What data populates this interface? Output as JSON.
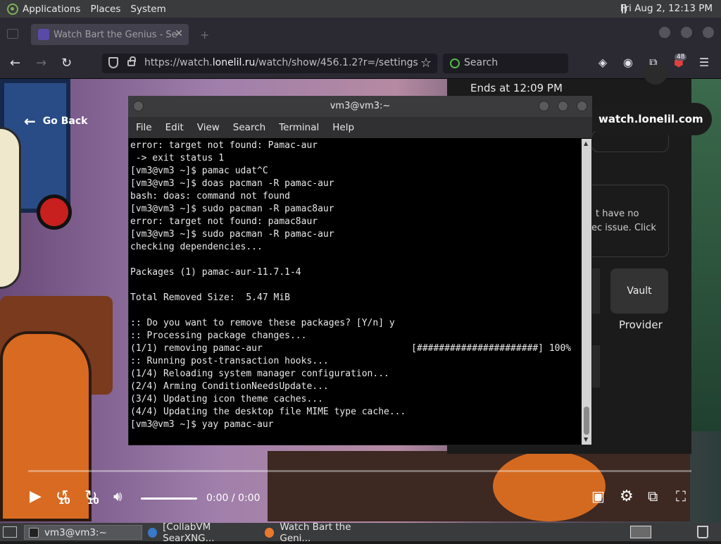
{
  "top_panel": {
    "applications": "Applications",
    "places": "Places",
    "system": "System",
    "clock": "Fri Aug  2, 12:13 PM"
  },
  "browser": {
    "tab_title": "Watch Bart the Genius - Se",
    "new_tab": "+",
    "url_domain_prefix": "https://watch.",
    "url_domain": "lonelil.ru",
    "url_path": "/watch/show/456.1.2?r=/settings",
    "search_placeholder": "Search",
    "extension_badge": "48"
  },
  "page": {
    "go_back": "Go Back",
    "ends_at": "Ends at 12:09 PM",
    "host_pill": "watch.lonelil.com",
    "card_text_line1": "t have no",
    "card_text_line2": "ec issue. Click",
    "vault": "Vault",
    "provider": "Provider",
    "time": "0:00 / 0:00",
    "skip_back": "10",
    "skip_forward": "10"
  },
  "terminal": {
    "title": "vm3@vm3:~",
    "menu": [
      "File",
      "Edit",
      "View",
      "Search",
      "Terminal",
      "Help"
    ],
    "lines": [
      "error: target not found: Pamac-aur",
      " -> exit status 1",
      "[vm3@vm3 ~]$ pamac udat^C",
      "[vm3@vm3 ~]$ doas pacman -R pamac-aur",
      "bash: doas: command not found",
      "[vm3@vm3 ~]$ sudo pacman -R pamac8aur",
      "error: target not found: pamac8aur",
      "[vm3@vm3 ~]$ sudo pacman -R pamac-aur",
      "checking dependencies...",
      "",
      "Packages (1) pamac-aur-11.7.1-4",
      "",
      "Total Removed Size:  5.47 MiB",
      "",
      ":: Do you want to remove these packages? [Y/n] y",
      ":: Processing package changes...",
      "(1/1) removing pamac-aur                           [######################] 100%",
      ":: Running post-transaction hooks...",
      "(1/4) Reloading system manager configuration...",
      "(2/4) Arming ConditionNeedsUpdate...",
      "(3/4) Updating icon theme caches...",
      "(4/4) Updating the desktop file MIME type cache...",
      "[vm3@vm3 ~]$ yay pamac-aur"
    ]
  },
  "taskbar": {
    "items": [
      {
        "label": "vm3@vm3:~"
      },
      {
        "label": "[CollabVM SearXNG..."
      },
      {
        "label": "Watch Bart the Geni..."
      }
    ]
  },
  "colors": {
    "panel": "#3a3b3d",
    "browser_chrome": "#2b2a33",
    "terminal_bg": "#000000"
  }
}
